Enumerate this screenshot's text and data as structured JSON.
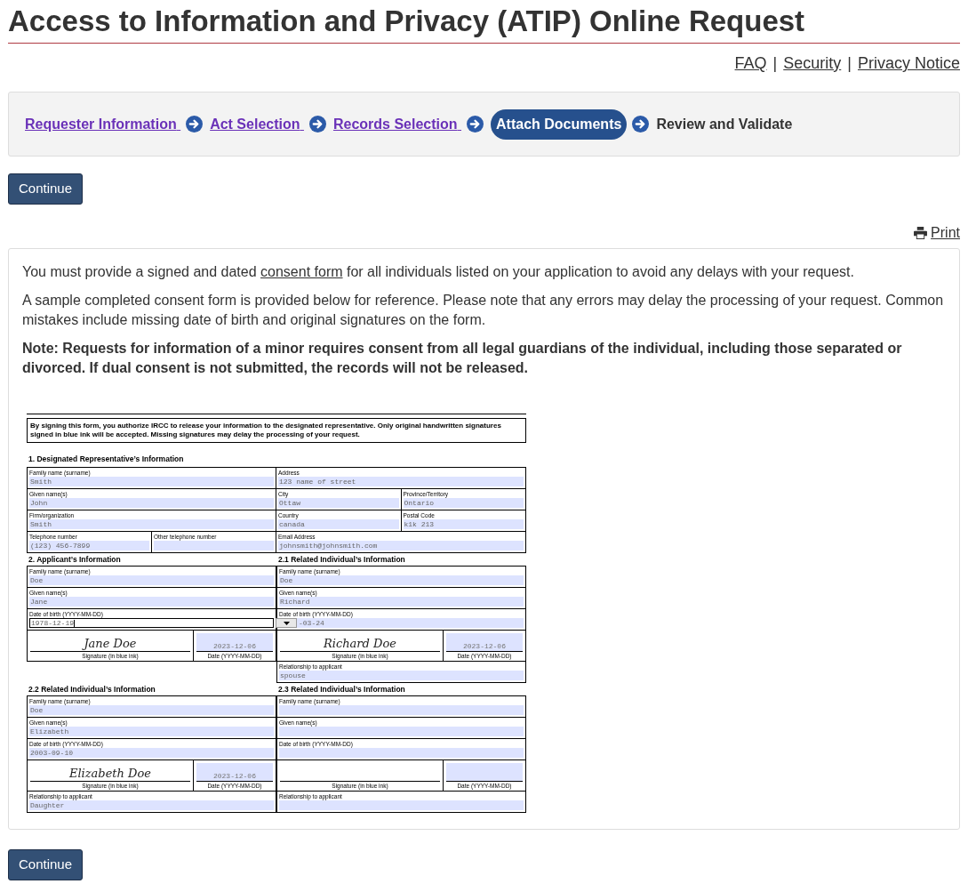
{
  "page_title": "Access to Information and Privacy (ATIP) Online Request",
  "top_links": [
    "FAQ",
    "Security",
    "Privacy Notice"
  ],
  "link_separators": [
    "|",
    "|"
  ],
  "steps": [
    {
      "label": "Requester Information",
      "selected": false,
      "visited": true
    },
    {
      "label": "Act Selection",
      "selected": false,
      "visited": true
    },
    {
      "label": "Records Selection",
      "selected": false,
      "visited": true
    },
    {
      "label": "Attach Documents",
      "selected": true
    },
    {
      "label": "Review and Validate",
      "selected": false,
      "visited": false
    }
  ],
  "continue_button": "Continue",
  "print_link": "Print",
  "intro": {
    "before": "You must provide a signed and dated ",
    "link": "consent form",
    "after": " for all individuals listed on your application to avoid any delays with your request."
  },
  "paragraph": "A sample completed consent form is provided below for reference. Please note that any errors may delay the processing of your request. Common mistakes include missing date of birth and original signatures on the form.",
  "note": "Note: Requests for information of a minor requires consent from all legal guardians of the individual, including those separated or divorced. If dual consent is not submitted, the records will not be released.",
  "sample_form": {
    "notice": "By signing this form, you authorize IRCC to release your information to the designated representative. Only original handwritten signatures signed in blue ink will be accepted. Missing signatures may delay the processing of your request.",
    "section_1": {
      "heading": "1. Designated Representative’s Information",
      "rows": [
        {
          "left": [
            {
              "label": "Family name (surname)",
              "value": "Smith"
            }
          ],
          "right": [
            {
              "label": "Address",
              "value": "123 name of street"
            }
          ]
        },
        {
          "left": [
            {
              "label": "Given name(s)",
              "value": "John"
            }
          ],
          "right": [
            {
              "label": "City",
              "value": "Ottaw"
            },
            {
              "label": "Province/Territory",
              "value": "Ontario"
            }
          ]
        },
        {
          "left": [
            {
              "label": "Firm/organization",
              "value": "Smith"
            }
          ],
          "right": [
            {
              "label": "Country",
              "value": "canada"
            },
            {
              "label": "Postal Code",
              "value": "k1k 213"
            }
          ]
        },
        {
          "left": [
            {
              "label": "Telephone number",
              "value": "(123) 456-7899"
            },
            {
              "label": "Other telephone number"
            }
          ],
          "right": [
            {
              "label": "Email Address",
              "value": "johnsmith@johnsmith.com"
            }
          ]
        }
      ]
    },
    "person_pairs": [
      [
        {
          "heading": "2. Applicant’s Information",
          "fields": [
            {
              "label": "Family name (surname)",
              "value": "Doe"
            },
            {
              "label": "Given name(s)",
              "value": "Jane"
            },
            {
              "label": "Date of birth (YYYY-MM-DD)",
              "value": "1978-12-19",
              "focused": true
            }
          ],
          "signature": "Jane Doe",
          "signature_label": "Signature (in blue ink)",
          "date": "2023-12-06",
          "date_label": "Date (YYYY-MM-DD)"
        },
        {
          "heading": "2.1 Related Individual’s Information",
          "fields": [
            {
              "label": "Family name (surname)",
              "value": "Doe"
            },
            {
              "label": "Given name(s)",
              "value": "Richard"
            },
            {
              "label": "Date of birth (YYYY-MM-DD)",
              "value": "-03-24",
              "obscured": true
            }
          ],
          "signature": "Richard Doe",
          "signature_label": "Signature (in blue ink)",
          "date": "2023-12-06",
          "date_label": "Date (YYYY-MM-DD)",
          "relationship": {
            "label": "Relationship to applicant",
            "value": "spouse"
          }
        }
      ],
      [
        {
          "heading": "2.2 Related Individual’s Information",
          "fields": [
            {
              "label": "Family name (surname)",
              "value": "Doe"
            },
            {
              "label": "Given name(s)",
              "value": "Elizabeth"
            },
            {
              "label": "Date of birth (YYYY-MM-DD)",
              "value": "2003-09-10"
            }
          ],
          "signature": "Elizabeth Doe",
          "signature_label": "Signature (in blue ink)",
          "date": "2023-12-06",
          "date_label": "Date (YYYY-MM-DD)",
          "relationship": {
            "label": "Relationship to applicant",
            "value": "Daughter"
          }
        },
        {
          "heading": "2.3 Related Individual’s Information",
          "fields": [
            {
              "label": "Family name (surname)"
            },
            {
              "label": "Given name(s)"
            },
            {
              "label": "Date of birth (YYYY-MM-DD)"
            }
          ],
          "signature_label": "Signature (in blue ink)",
          "date_label": "Date (YYYY-MM-DD)",
          "relationship": {
            "label": "Relationship to applicant"
          }
        }
      ]
    ]
  },
  "continue_button_bottom": "Continue"
}
